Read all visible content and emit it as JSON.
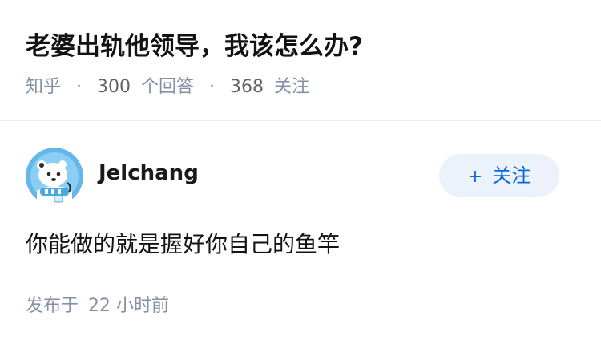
{
  "question": {
    "title": "老婆出轨他领导，我该怎么办?",
    "source": "知乎",
    "separator": "·",
    "answer_count": "300",
    "answer_label": "个回答",
    "follower_count": "368",
    "follower_label": "关注"
  },
  "answer": {
    "author": {
      "name": "Jelchang",
      "avatar_icon": "bear-avatar-icon"
    },
    "follow_button": {
      "icon": "+",
      "label": "关注"
    },
    "content": "你能做的就是握好你自己的鱼竿",
    "time_prefix": "发布于",
    "time_value": "22 小时前"
  },
  "colors": {
    "title": "#121212",
    "meta": "#8590a6",
    "accent": "#0a66d8",
    "follow_bg": "#ebf2fb",
    "divider": "#ececec"
  }
}
